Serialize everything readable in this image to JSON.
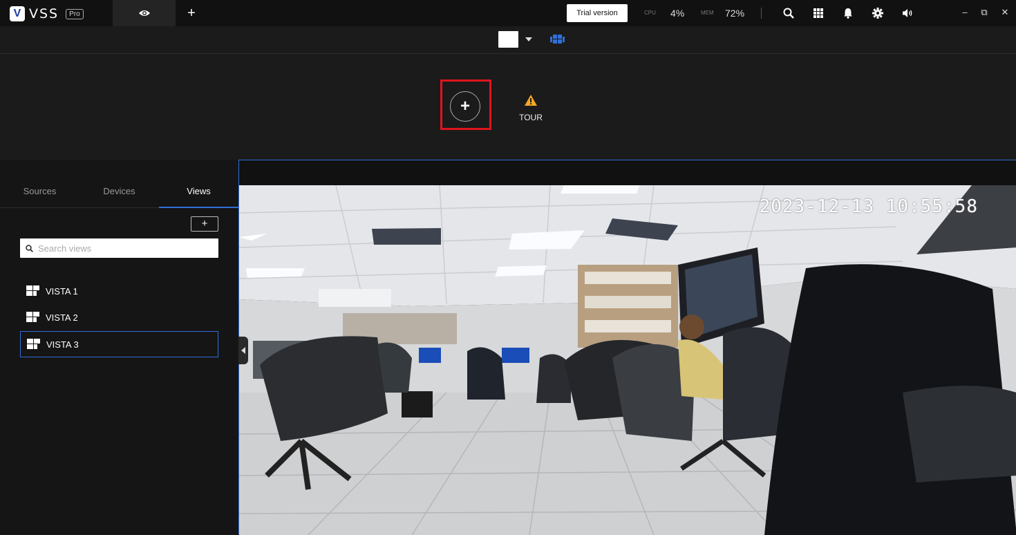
{
  "app": {
    "name": "VSS",
    "badge": "Pro"
  },
  "topbar": {
    "add_tab": "+",
    "trial_label": "Trial version",
    "cpu_label": "CPU",
    "cpu_value": "4%",
    "mem_label": "MEM",
    "mem_value": "72%",
    "icons": [
      "search-icon",
      "apps-grid-icon",
      "bell-icon",
      "gear-icon",
      "volume-icon"
    ]
  },
  "window_controls": {
    "minimize": "–",
    "restore": "⧉",
    "close": "✕"
  },
  "empty_view": {
    "add_symbol": "+",
    "tour_label": "TOUR",
    "tour_icon_color": "#f5a623",
    "highlight_color": "#e0141c"
  },
  "left_panel": {
    "tabs": [
      {
        "label": "Sources",
        "active": false
      },
      {
        "label": "Devices",
        "active": false
      },
      {
        "label": "Views",
        "active": true
      }
    ],
    "add_label": "+",
    "search_placeholder": "Search views",
    "views": [
      {
        "label": "VISTA 1",
        "selected": false
      },
      {
        "label": "VISTA 2",
        "selected": false
      },
      {
        "label": "VISTA 3",
        "selected": true
      }
    ]
  },
  "camera": {
    "timestamp": "2023-12-13 10:55:58"
  },
  "colors": {
    "accent": "#2f6fd8",
    "topbar_bg": "#111111",
    "panel_bg": "#151515"
  }
}
